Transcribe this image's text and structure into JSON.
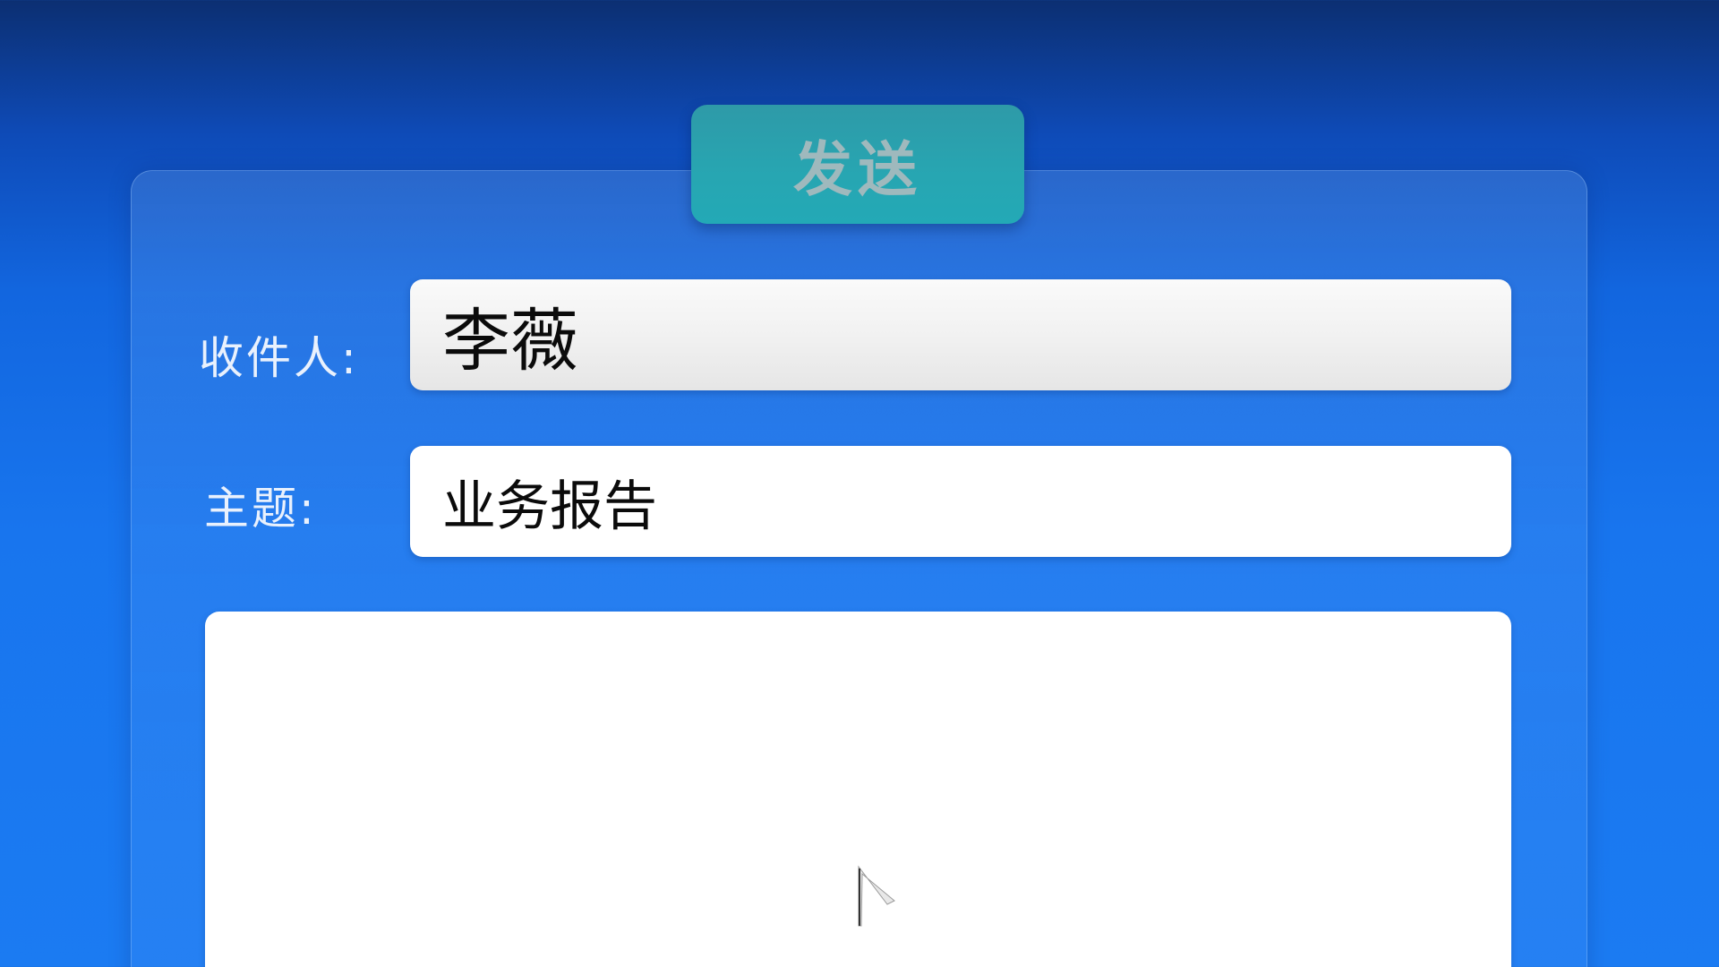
{
  "compose": {
    "send_label": "发送",
    "to_label": "收件人:",
    "to_value": "李薇",
    "subject_label": "主题:",
    "subject_value": "业务报告",
    "body_value": ""
  },
  "colors": {
    "background": "#1875ee",
    "send_button": "#27a6b2",
    "send_text": "#9fb9bd",
    "label_text": "#e9f1fd",
    "field_bg": "#ffffff"
  },
  "icons": {
    "cursor": "mouse-pointer-icon"
  }
}
